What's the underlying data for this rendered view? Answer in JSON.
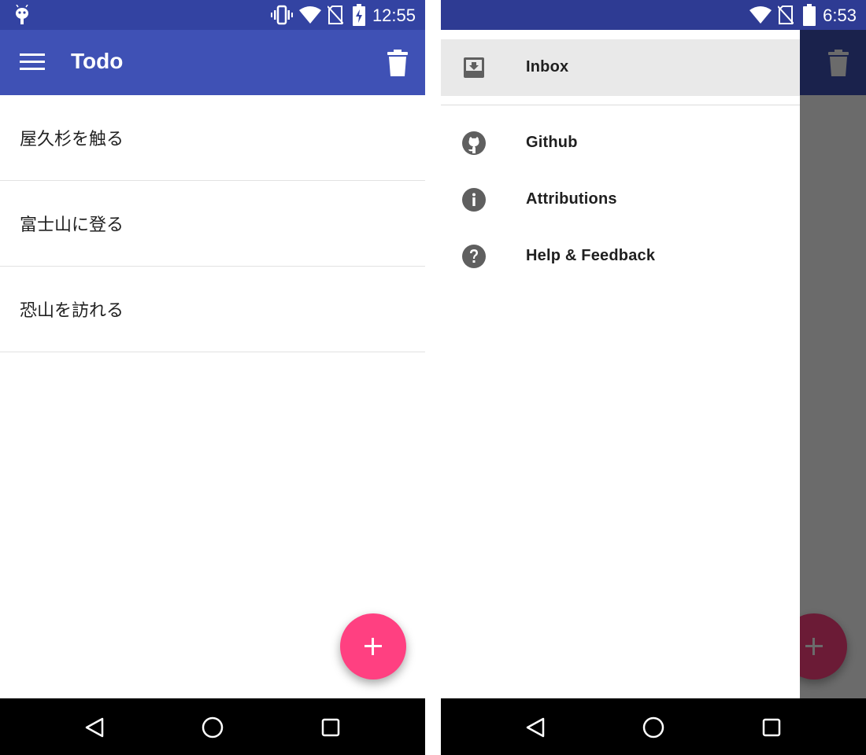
{
  "left_screen": {
    "status_bar": {
      "time": "12:55"
    },
    "app_bar": {
      "title": "Todo"
    },
    "todos": [
      "屋久杉を触る",
      "富士山に登る",
      "恐山を訪れる"
    ],
    "colors": {
      "primary": "#3f51b5",
      "primary_dark": "#3343a2",
      "accent": "#ff4081"
    }
  },
  "right_screen": {
    "status_bar": {
      "time": "6:53"
    },
    "drawer": {
      "items": [
        {
          "label": "Inbox",
          "icon": "inbox-icon",
          "selected": true
        },
        {
          "label": "Github",
          "icon": "github-icon",
          "selected": false
        },
        {
          "label": "Attributions",
          "icon": "info-icon",
          "selected": false
        },
        {
          "label": "Help & Feedback",
          "icon": "help-icon",
          "selected": false
        }
      ]
    }
  }
}
